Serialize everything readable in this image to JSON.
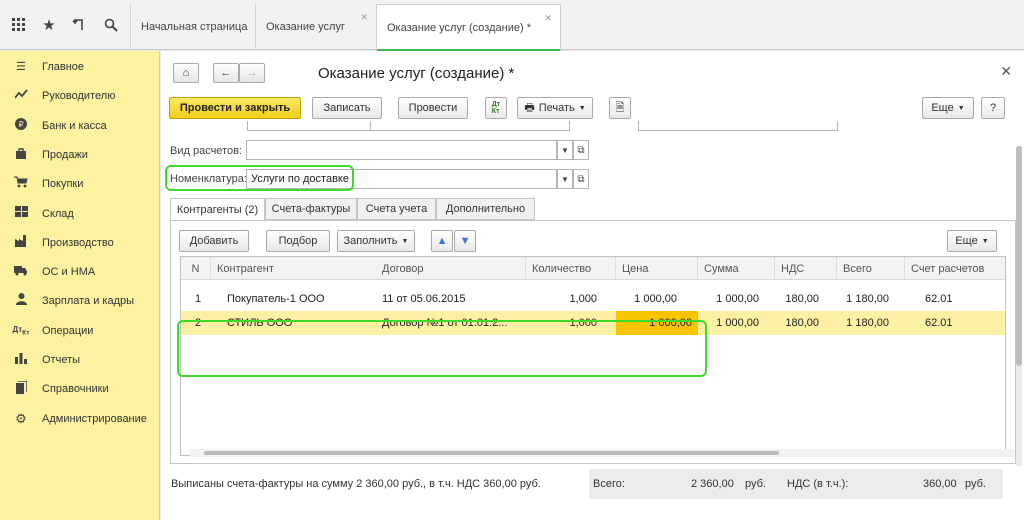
{
  "tabs": [
    {
      "label": "Начальная страница"
    },
    {
      "label": "Оказание услуг"
    },
    {
      "label": "Оказание услуг (создание) *"
    }
  ],
  "sidebar": {
    "items": [
      {
        "label": "Главное",
        "icon": "menu-icon"
      },
      {
        "label": "Руководителю",
        "icon": "trend-icon"
      },
      {
        "label": "Банк и касса",
        "icon": "ruble-icon"
      },
      {
        "label": "Продажи",
        "icon": "bag-icon"
      },
      {
        "label": "Покупки",
        "icon": "cart-icon"
      },
      {
        "label": "Склад",
        "icon": "warehouse-icon"
      },
      {
        "label": "Производство",
        "icon": "factory-icon"
      },
      {
        "label": "ОС и НМА",
        "icon": "truck-icon"
      },
      {
        "label": "Зарплата и кадры",
        "icon": "person-icon"
      },
      {
        "label": "Операции",
        "icon": "dt-kt-icon"
      },
      {
        "label": "Отчеты",
        "icon": "bar-chart-icon"
      },
      {
        "label": "Справочники",
        "icon": "book-icon"
      },
      {
        "label": "Администрирование",
        "icon": "gear-icon"
      }
    ]
  },
  "form": {
    "title": "Оказание услуг (создание) *",
    "toolbar": {
      "post_close": "Провести и закрыть",
      "save": "Записать",
      "post": "Провести",
      "print": "Печать",
      "more": "Еще",
      "help": "?"
    },
    "fields": {
      "settlement_label": "Вид расчетов:",
      "settlement_value": "",
      "nomenclature_label": "Номенклатура:",
      "nomenclature_value": "Услуги по доставке"
    },
    "inner_tabs": [
      "Контрагенты (2)",
      "Счета-фактуры",
      "Счета учета",
      "Дополнительно"
    ],
    "table_toolbar": {
      "add": "Добавить",
      "select": "Подбор",
      "fill": "Заполнить",
      "more": "Еще"
    },
    "table": {
      "columns": [
        "N",
        "Контрагент",
        "Договор",
        "Количество",
        "Цена",
        "Сумма",
        "НДС",
        "Всего",
        "Счет расчетов"
      ],
      "rows": [
        {
          "n": "1",
          "counterparty": "Покупатель-1 ООО",
          "contract": "11 от 05.06.2015",
          "qty": "1,000",
          "price": "1 000,00",
          "sum": "1 000,00",
          "vat": "180,00",
          "total": "1 180,00",
          "account": "62.01"
        },
        {
          "n": "2",
          "counterparty": "СТИЛЬ ООО",
          "contract": "Договор №1 от 01.01.2...",
          "qty": "1,000",
          "price": "1 000,00",
          "sum": "1 000,00",
          "vat": "180,00",
          "total": "1 180,00",
          "account": "62.01"
        }
      ]
    },
    "footer": {
      "invoice_text": "Выписаны счета-фактуры на сумму 2 360,00 руб., в т.ч. НДС 360,00 руб.",
      "total_label": "Всего:",
      "total_value": "2 360,00",
      "total_currency": "руб.",
      "vat_label": "НДС (в т.ч.):",
      "vat_value": "360,00",
      "vat_currency": "руб."
    }
  },
  "colors": {
    "sidebar_bg": "#fdf2a0",
    "primary_button": "#f1cf1a",
    "highlight": "#3ddc2a",
    "selected_row": "#fbf0a4",
    "active_cell": "#f7c500",
    "active_tab_line": "#3fb74d"
  }
}
